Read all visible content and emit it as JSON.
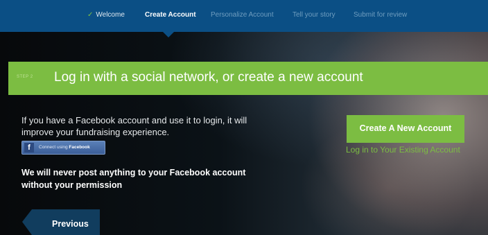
{
  "nav": {
    "steps": [
      {
        "label": "Welcome",
        "state": "done"
      },
      {
        "label": "Create Account",
        "state": "active"
      },
      {
        "label": "Personalize Account",
        "state": "upcoming"
      },
      {
        "label": "Tell your story",
        "state": "upcoming"
      },
      {
        "label": "Submit for review",
        "state": "upcoming"
      }
    ],
    "check_icon": "✓"
  },
  "step": {
    "label": "STEP 2",
    "title": "Log in with a social network, or create a new account"
  },
  "facebook": {
    "intro": "If you have a Facebook account and use it to login, it will improve your fundraising experience.",
    "button_prefix": "Connect using ",
    "button_brand": "Facebook",
    "icon_glyph": "f",
    "privacy_note": "We will never post anything to your Facebook account without your permission"
  },
  "actions": {
    "create_account": "Create A New Account",
    "login_existing": "Log in to Your Existing Account",
    "previous": "Previous"
  },
  "colors": {
    "nav_bg": "#0b4f85",
    "accent_green": "#7cbd42",
    "facebook_blue": "#3b5e98",
    "previous_bg": "#113d5e"
  }
}
